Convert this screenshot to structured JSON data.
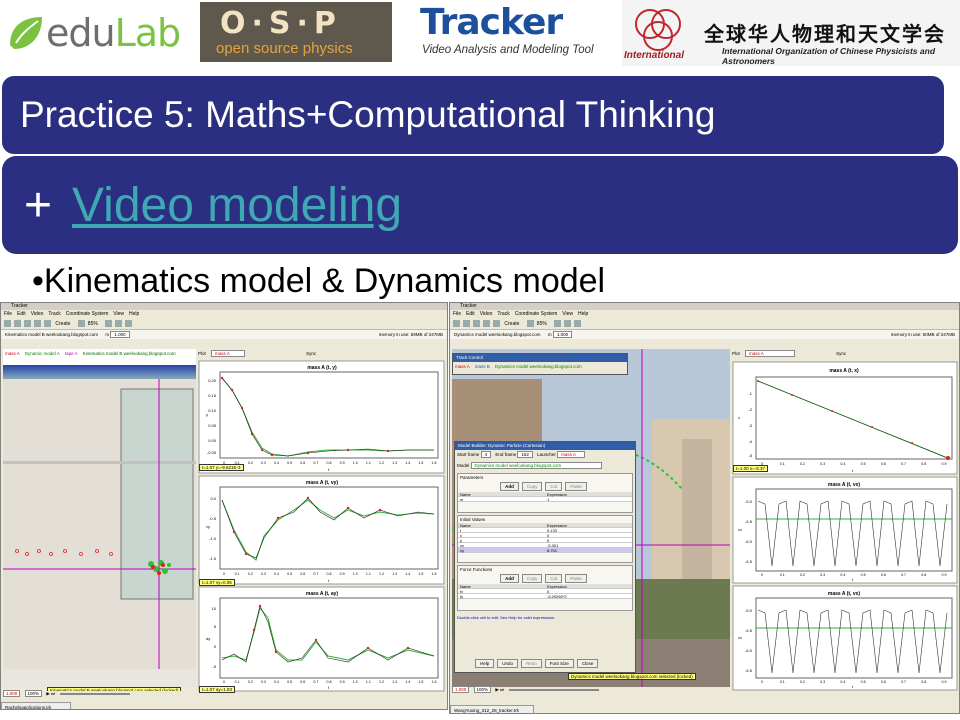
{
  "logos": {
    "edulab": {
      "pre": "edu",
      "post": "Lab"
    },
    "osp": {
      "big": "O·S·P",
      "small": "open source physics"
    },
    "tracker": {
      "title": "Tracker",
      "subtitle": "Video Analysis and Modeling Tool"
    },
    "iocp": {
      "chinese": "全球华人物理和天文学会",
      "english": "International Organization of Chinese Physicists and Astronomers",
      "tag": "International"
    }
  },
  "slide": {
    "title": "Practice 5: Maths+Computational Thinking",
    "plus": "+",
    "link_text": "Video modeling",
    "bullet": "•Kinematics model & Dynamics model"
  },
  "left_window": {
    "title": "Tracker",
    "menu": [
      "File",
      "Edit",
      "Video",
      "Track",
      "Coordinate System",
      "View",
      "Help"
    ],
    "toolbar_create": "Create",
    "toolbar_zoom": "85%",
    "info_label": "Kinematics model B weelookang.blogspot.com",
    "m_label": "m",
    "m_value": "1.000",
    "memory": "memory in use: 59MB of 247MB",
    "legend": [
      "mass A",
      "Dynamic model A",
      "tape A",
      "Kinematics model B weelookang.blogspot.com"
    ],
    "plot_selector": "Plot",
    "plot_track": "mass A",
    "sync": "Sync",
    "plots": [
      {
        "title": "mass A (t, y)",
        "xlabel": "t",
        "ylabel": "y",
        "yticks": [
          "0.20",
          "0.15",
          "0.10",
          "0.05",
          "0.00",
          "-0.05"
        ],
        "readout": "t=1.07  y=-9.621E-3"
      },
      {
        "title": "mass A (t, vy)",
        "xlabel": "t",
        "ylabel": "vy",
        "yticks": [
          "0.0",
          "-0.5",
          "-1.0",
          "-1.5"
        ],
        "readout": "t=1.07  vy=0.06"
      },
      {
        "title": "mass A (t, ay)",
        "xlabel": "t",
        "ylabel": "ay",
        "yticks": [
          "10",
          "5",
          "0",
          "-5"
        ],
        "readout": "t=1.07  ay=1.83"
      }
    ],
    "xticks": [
      "0",
      "0.1",
      "0.2",
      "0.3",
      "0.4",
      "0.5",
      "0.6",
      "0.7",
      "0.8",
      "0.9",
      "1.0",
      "1.1",
      "1.2",
      "1.3",
      "1.4",
      "1.5",
      "1.6"
    ],
    "status": "Kinematics model B weelookang.blogspot.com selected (locked)",
    "frame_value": "1.000",
    "zoom_value": "100%",
    "taskbar_file": "Rachelsapplications.trk"
  },
  "right_window": {
    "title": "Tracker",
    "menu": [
      "File",
      "Edit",
      "Video",
      "Track",
      "Coordinate System",
      "View",
      "Help"
    ],
    "toolbar_create": "Create",
    "toolbar_zoom": "85%",
    "info_label": "Dynamics model weelookang.blogspot.com",
    "m_label": "m",
    "m_value": "1.000",
    "memory": "memory in use: 50MB of 247MB",
    "track_control": {
      "title": "Track Control",
      "items": [
        "mass A",
        "mass B",
        "Dynamics model weelookang.blogspot.com"
      ]
    },
    "plot_selector": "Plot",
    "plot_track": "mass A",
    "sync": "Sync",
    "plot_top": {
      "title": "mass A (t, x)",
      "xlabel": "t",
      "ylabel": "x",
      "auto": "Auto",
      "field": "0.0003",
      "yticks": [
        "-1",
        "-2",
        "-3",
        "-4",
        "-5"
      ],
      "readout": "t=1.00  x=-5.37"
    },
    "plot_mid": {
      "title": "mass A (t, vx)",
      "xlabel": "t",
      "ylabel": "vx",
      "yticks": [
        "-5.0",
        "-5.5",
        "-6.0",
        "-6.5"
      ]
    },
    "plot_bot": {
      "title": "mass A (t, vx)",
      "xlabel": "t",
      "ylabel": "vx",
      "yticks": [
        "-5.0",
        "-5.5",
        "-6.0",
        "-6.5"
      ]
    },
    "xticks": [
      "0",
      "0.1",
      "0.2",
      "0.3",
      "0.4",
      "0.5",
      "0.6",
      "0.7",
      "0.8",
      "0.9"
    ],
    "status": "Dynamics model weelookang.blogspot.com selected (locked)",
    "frame_value": "1.000",
    "zoom_value": "100%",
    "taskbar_file": "WangYuxing_312_28_tracker.trk"
  },
  "model_builder": {
    "title": "Model Builder: Dynamic Particle (Cartesian)",
    "start_label": "Start frame",
    "start_value": "4",
    "end_label": "End frame",
    "end_value": "162",
    "launcher_label": "Launcher",
    "launcher_value": "mass A",
    "model_label": "Model",
    "model_value": "Dynamics model weelookang.blogspot.com",
    "parameters_title": "Parameters",
    "buttons": [
      "Add",
      "Copy",
      "Cut",
      "Paste"
    ],
    "col_name": "Name",
    "col_expression": "Expression",
    "parameters": [
      {
        "name": "m",
        "expr": "1"
      }
    ],
    "initial_title": "Initial Values",
    "initial": [
      {
        "name": "t",
        "expr": "0.133"
      },
      {
        "name": "x",
        "expr": "0"
      },
      {
        "name": "y",
        "expr": "0"
      },
      {
        "name": "vx",
        "expr": "-5.301"
      },
      {
        "name": "vy",
        "expr": "6.701"
      }
    ],
    "force_title": "Force Functions",
    "forces": [
      {
        "name": "fx",
        "expr": "0"
      },
      {
        "name": "fy",
        "expr": "-5.29260*2"
      }
    ],
    "hint": "Double-click cell to edit. See Help for valid expressions.",
    "footer_buttons": [
      "Help",
      "Undo",
      "Redo",
      "Font Size",
      "Close"
    ]
  }
}
